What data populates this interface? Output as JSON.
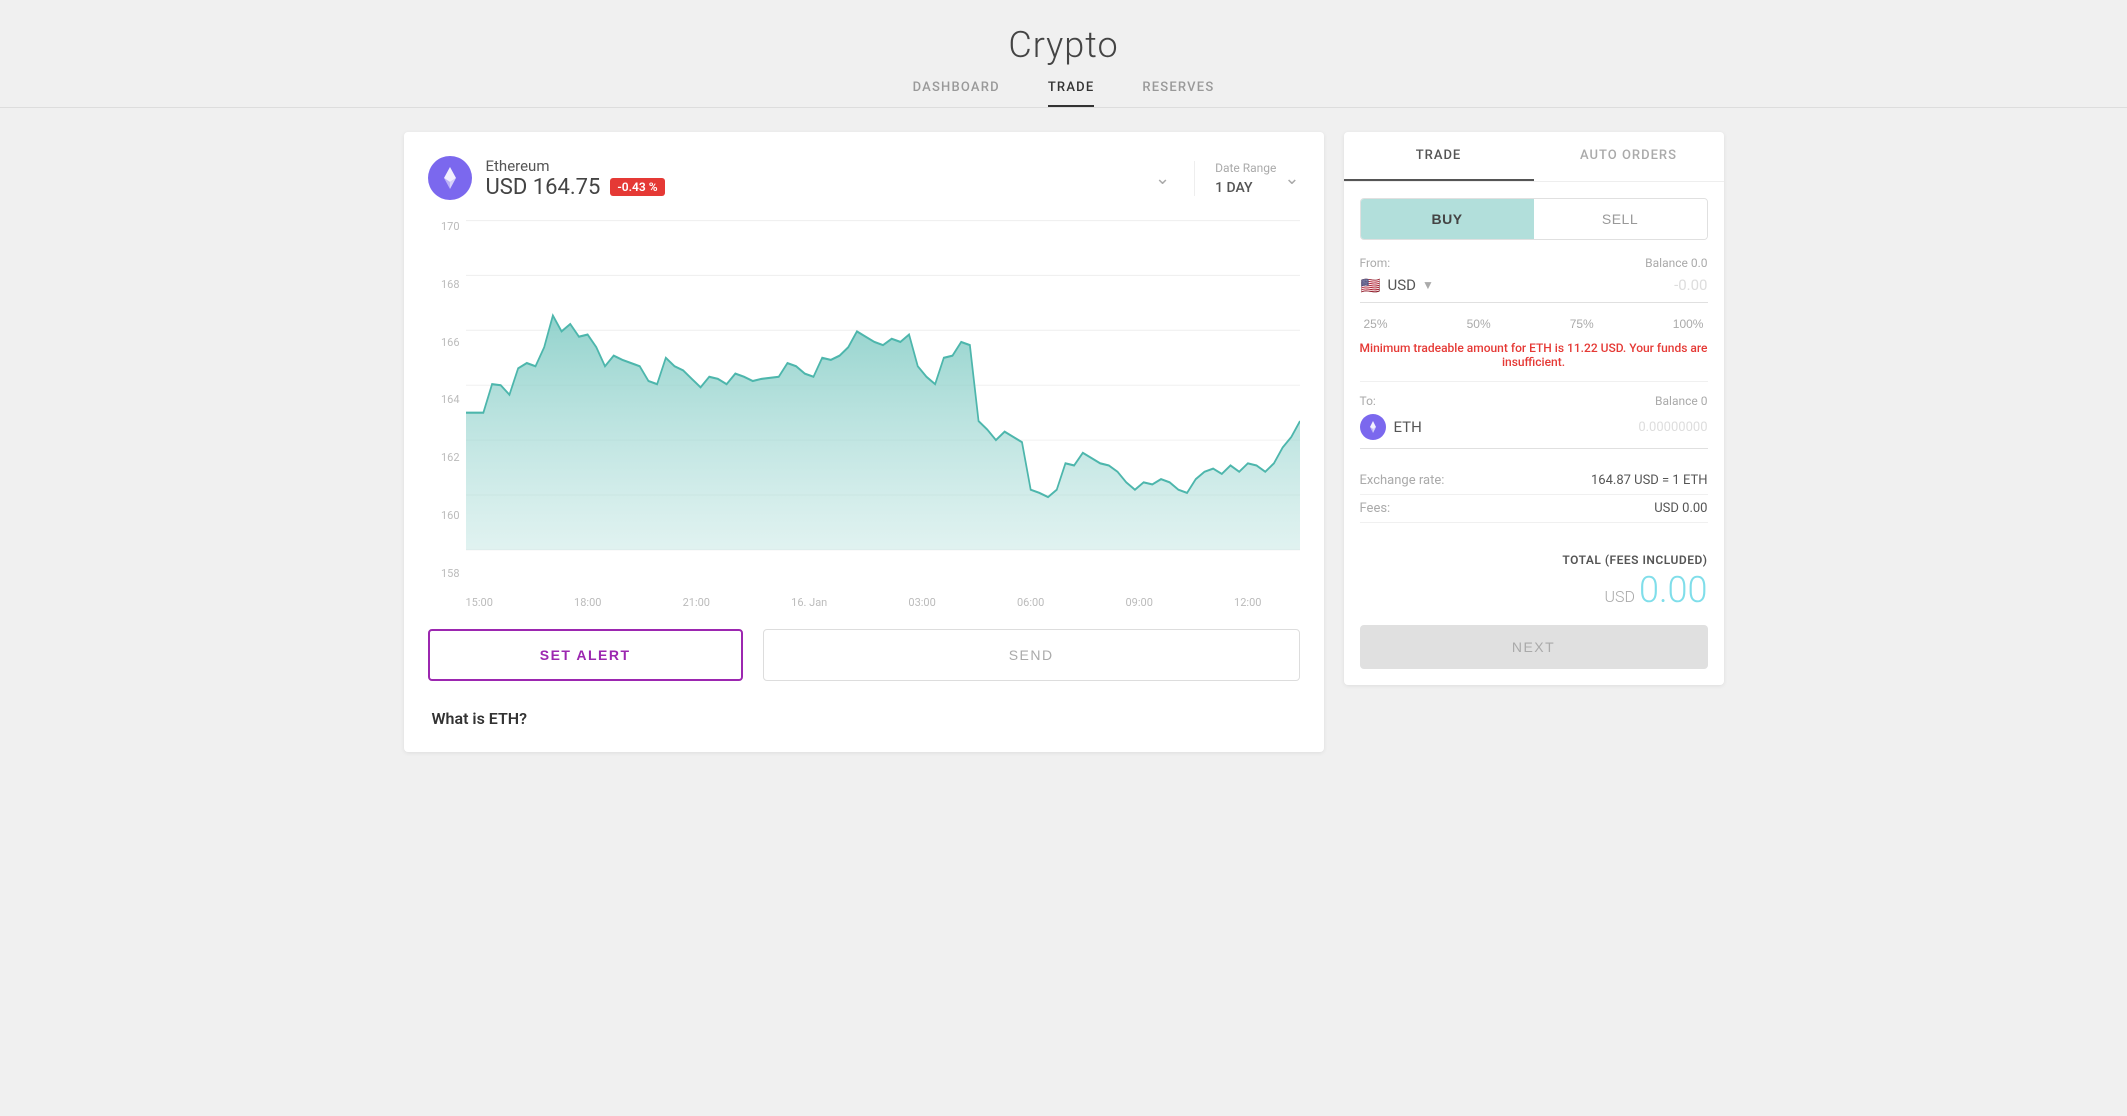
{
  "header": {
    "title": "Crypto",
    "nav": [
      {
        "label": "DASHBOARD",
        "active": false
      },
      {
        "label": "TRADE",
        "active": true
      },
      {
        "label": "RESERVES",
        "active": false
      }
    ]
  },
  "chart": {
    "coin_name": "Ethereum",
    "coin_ticker": "ETH",
    "price_label": "USD 164.75",
    "price_change": "-0.43 %",
    "date_range_label": "Date Range",
    "date_range_value": "1 DAY",
    "y_labels": [
      "170",
      "168",
      "166",
      "164",
      "162",
      "160",
      "158"
    ],
    "x_labels": [
      "15:00",
      "18:00",
      "21:00",
      "16. Jan",
      "03:00",
      "06:00",
      "09:00",
      "12:00"
    ]
  },
  "buttons": {
    "set_alert": "SET ALERT",
    "send": "SEND"
  },
  "what_is": {
    "title": "What is ETH?"
  },
  "right_panel": {
    "tabs": [
      {
        "label": "TRADE",
        "active": true
      },
      {
        "label": "AUTO ORDERS",
        "active": false
      }
    ],
    "buy_label": "BUY",
    "sell_label": "SELL",
    "from_label": "From:",
    "balance_from": "Balance 0.0",
    "currency": "USD",
    "amount_from": "-0.00",
    "pct_buttons": [
      "25%",
      "50%",
      "75%",
      "100%"
    ],
    "error_msg": "Minimum tradeable amount for ETH is 11.22 USD. Your funds are insufficient.",
    "to_label": "To:",
    "balance_to": "Balance 0",
    "eth_label": "ETH",
    "eth_amount": "0.00000000",
    "exchange_rate_label": "Exchange rate:",
    "exchange_rate_value": "164.87 USD = 1 ETH",
    "fees_label": "Fees:",
    "fees_value": "USD 0.00",
    "total_label": "TOTAL (fees included)",
    "total_currency": "USD",
    "total_amount": "0.00",
    "next_label": "NEXT"
  }
}
